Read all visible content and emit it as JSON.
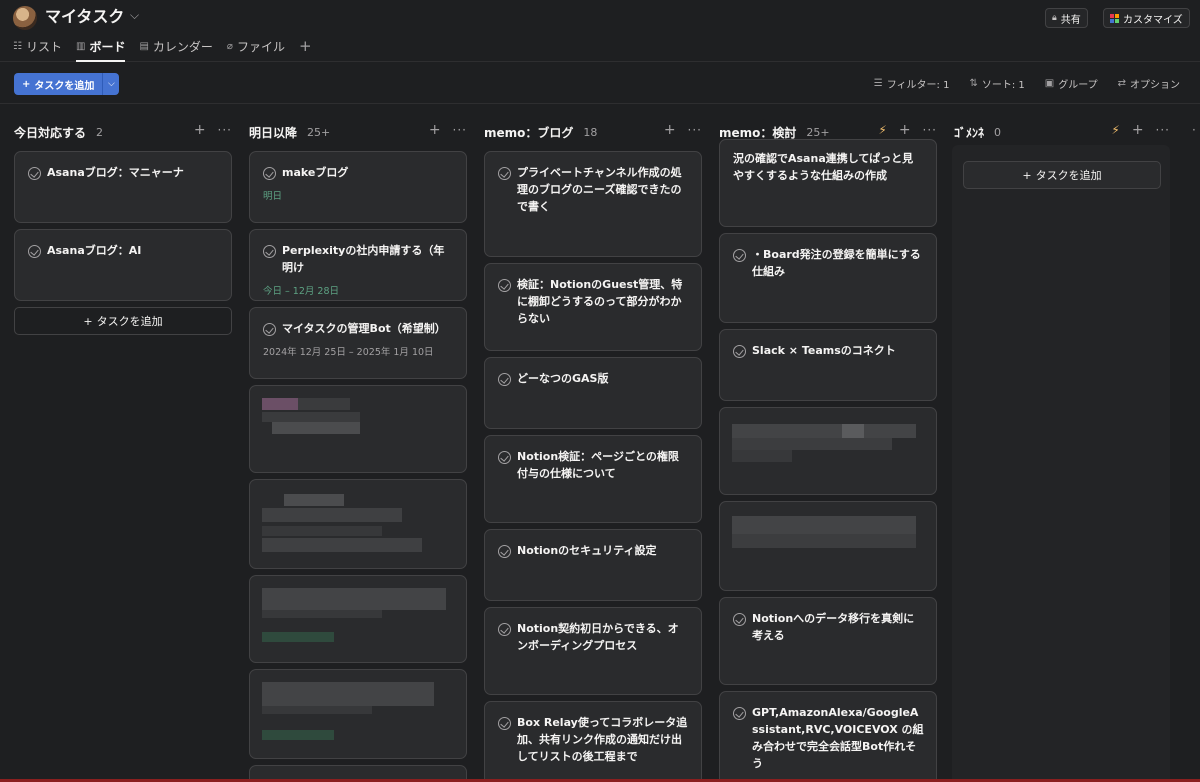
{
  "header": {
    "title": "マイタスク",
    "tabs": [
      {
        "label": "リスト",
        "icon": "list-icon"
      },
      {
        "label": "ボード",
        "icon": "board-icon"
      },
      {
        "label": "カレンダー",
        "icon": "calendar-icon"
      },
      {
        "label": "ファイル",
        "icon": "paperclip-icon"
      }
    ],
    "share_label": "共有",
    "customize_label": "カスタマイズ"
  },
  "toolbar": {
    "add_task_label": "タスクを追加",
    "filter_label": "フィルター: 1",
    "sort_label": "ソート: 1",
    "group_label": "グループ",
    "options_label": "オプション"
  },
  "columns": [
    {
      "title": "今日対応する",
      "count": "2",
      "cards": [
        {
          "text": "Asanaブログ：マニャーナ"
        },
        {
          "text": "Asanaブログ：AI"
        }
      ],
      "add_label": "タスクを追加"
    },
    {
      "title": "明日以降",
      "count": "25+",
      "cards": [
        {
          "text": "makeブログ",
          "sub": "明日"
        },
        {
          "text": "Perplexityの社内申請する（年明け",
          "sub": "今日 – 12月 28日"
        },
        {
          "text": "マイタスクの管理Bot（希望制）",
          "sub": "2024年 12月 25日 – 2025年 1月 10日"
        }
      ]
    },
    {
      "title": "memo：ブログ",
      "count": "18",
      "cards": [
        {
          "text": "プライベートチャンネル作成の処理のブログのニーズ確認できたので書く"
        },
        {
          "text": "検証：NotionのGuest管理、特に棚卸どうするのって部分がわからない"
        },
        {
          "text": "どーなつのGAS版"
        },
        {
          "text": "Notion検証：ページごとの権限付与の仕様について"
        },
        {
          "text": "Notionのセキュリティ設定"
        },
        {
          "text": "Notion契約初日からできる、オンボーディングプロセス"
        },
        {
          "text": "Box Relay使ってコラボレータ追加、共有リンク作成の通知だけ出してリストの後工程まで"
        }
      ]
    },
    {
      "title": "memo：検討",
      "count": "25+",
      "cards": [
        {
          "text": "況の確認でAsana連携してぱっと見やすくするような仕組みの作成"
        },
        {
          "text": "・Board発注の登録を簡単にする仕組み"
        },
        {
          "text": "Slack × Teamsのコネクト"
        },
        {
          "text": "Notionへのデータ移行を真剣に考える"
        },
        {
          "text": "GPT,AmazonAlexa/GoogleAssistant,RVC,VOICEVOX の組み合わせで完全会話型Bot作れそう"
        }
      ]
    },
    {
      "title": "ｺﾞﾒﾝﾈ",
      "count": "0",
      "cards": [],
      "add_label": "タスクを追加"
    }
  ],
  "colors": {
    "accent": "#4573d2",
    "background": "#1e1f21",
    "card": "#2a2b2d",
    "date_green": "#5da283",
    "bolt": "#f1bd6c"
  }
}
